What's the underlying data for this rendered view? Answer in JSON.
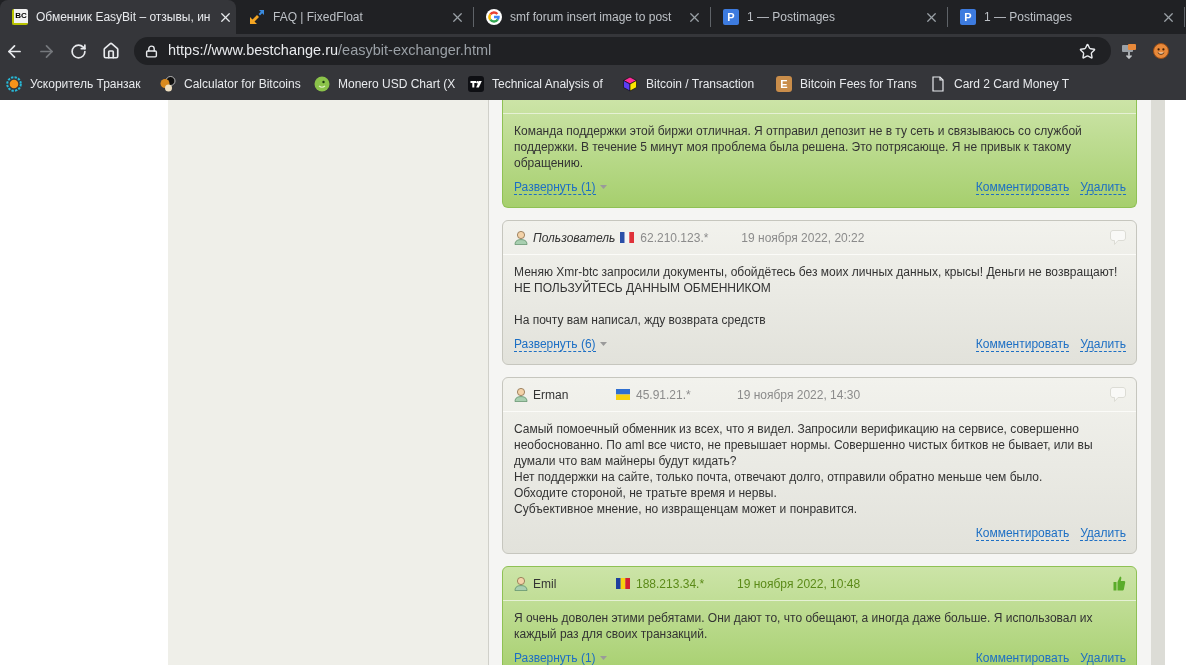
{
  "browser": {
    "tabs": [
      {
        "title": "Обменник EasyBit – отзывы, ин",
        "selected": true,
        "favicon_text": "BC"
      },
      {
        "title": "FAQ | FixedFloat",
        "selected": false
      },
      {
        "title": "smf forum insert image to post",
        "selected": false
      },
      {
        "title": "1 — Postimages",
        "selected": false,
        "favicon_text": "P"
      },
      {
        "title": "1 — Postimages",
        "selected": false,
        "favicon_text": "P"
      }
    ],
    "back_disabled": false,
    "forward_disabled": true,
    "address": {
      "host": "https://www.bestchange.ru",
      "path": "/easybit-exchanger.html"
    },
    "bookmarks": [
      {
        "label": "Ускоритель Транзак"
      },
      {
        "label": "Calculator for Bitcoins"
      },
      {
        "label": "Monero USD Chart (X"
      },
      {
        "label": "Technical Analysis of"
      },
      {
        "label": "Bitcoin / Transaction"
      },
      {
        "label": "Bitcoin Fees for Trans",
        "icon_text": "E"
      },
      {
        "label": "Card 2 Card Money T"
      }
    ]
  },
  "reviews": [
    {
      "kind": "positive",
      "header_hidden": true,
      "text": "Команда поддержки этой биржи отличная. Я отправил депозит не в ту сеть и связываюсь со службой поддержки. В течение 5 минут моя проблема была решена. Это потрясающе. Я не привык к такому обращению.",
      "expand": "Развернуть (1)",
      "actions": [
        "Комментировать",
        "Удалить"
      ]
    },
    {
      "kind": "neutral",
      "header_hidden": false,
      "author": "Пользователь",
      "anonymous": true,
      "ip": "62.210.123.*",
      "date": "19 ноября 2022, 20:22",
      "text": "Меняю Xmr-btc запросили документы, обойдётесь без моих личных данных, крысы! Деньги не возвращают!\nНЕ ПОЛЬЗУЙТЕСЬ ДАННЫМ ОБМЕННИКОМ\n\nНа почту вам написал, жду возврата средств",
      "expand": "Развернуть (6)",
      "actions": [
        "Комментировать",
        "Удалить"
      ]
    },
    {
      "kind": "neutral",
      "header_hidden": false,
      "author": "Erman",
      "anonymous": false,
      "ip": "45.91.21.*",
      "date": "19 ноября 2022, 14:30",
      "text": "Самый помоечный обменник из всех, что я видел. Запросили верификацию на сервисе, совершенно необоснованно. По aml все чисто, не превышает нормы. Совершенно чистых битков не бывает, или вы думали что вам майнеры будут кидать?\nНет поддержки на сайте, только почта, отвечают долго, отправили обратно меньше чем было.\nОбходите стороной, не тратьте время и нервы.\nСубъективное мнение, но извращенцам может и понравится.",
      "actions": [
        "Комментировать",
        "Удалить"
      ]
    },
    {
      "kind": "positive",
      "header_hidden": false,
      "author": "Emil",
      "anonymous": false,
      "ip": "188.213.34.*",
      "date": "19 ноября 2022, 10:48",
      "text": "Я очень доволен этими ребятами. Они дают то, что обещают, а иногда даже больше. Я использовал их каждый раз для своих транзакций.",
      "expand": "Развернуть (1)",
      "actions": [
        "Комментировать",
        "Удалить"
      ]
    }
  ]
}
